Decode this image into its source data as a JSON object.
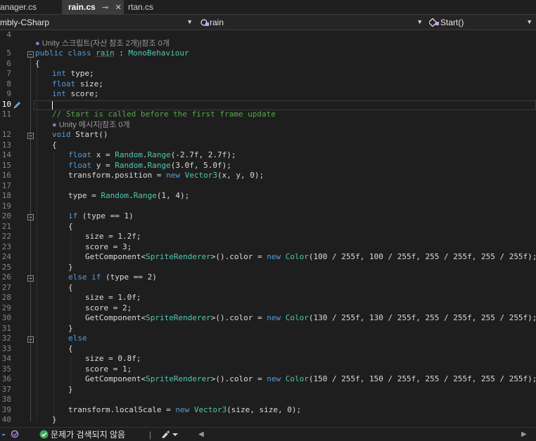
{
  "tabs": [
    {
      "label": "anager.cs",
      "active": false
    },
    {
      "label": "rain.cs",
      "active": true,
      "pin": "⊸",
      "close": "✕"
    },
    {
      "label": "rtan.cs",
      "active": false
    }
  ],
  "nav": {
    "project": "mbly-CSharp",
    "class": "rain",
    "member": "Start()"
  },
  "codelens": {
    "class_refs": "Unity 스크립트(자산 참조 2개)|참조 0개",
    "method_refs": "Unity 메시지|참조 0개"
  },
  "status": {
    "issues": "문제가 검색되지 않음"
  },
  "line_numbers": [
    "4",
    "5",
    "6",
    "7",
    "8",
    "9",
    "10",
    "11",
    "12",
    "13",
    "14",
    "15",
    "16",
    "17",
    "18",
    "19",
    "20",
    "21",
    "22",
    "23",
    "24",
    "25",
    "26",
    "27",
    "28",
    "29",
    "30",
    "31",
    "32",
    "33",
    "34",
    "35",
    "36",
    "37",
    "38",
    "39",
    "40"
  ],
  "code": {
    "l5": [
      "public",
      "class",
      "rain",
      ":",
      "MonoBehaviour"
    ],
    "l6": "{",
    "l7": [
      "int",
      "type;"
    ],
    "l8": [
      "float",
      "size;"
    ],
    "l9": [
      "int",
      "score;"
    ],
    "l11": "// Start is called before the first frame update",
    "l12": [
      "void",
      "Start()"
    ],
    "l13": "{",
    "l14": [
      "float",
      "x = ",
      "Random",
      ".",
      "Range",
      "(-2.7f, 2.7f);"
    ],
    "l15": [
      "float",
      "y = ",
      "Random",
      ".",
      "Range",
      "(3.0f, 5.0f);"
    ],
    "l16": [
      "transform.position = ",
      "new",
      "Vector3",
      "(x, y, 0);"
    ],
    "l18": [
      "type = ",
      "Random",
      ".",
      "Range",
      "(1, 4);"
    ],
    "l20": [
      "if",
      " (type == 1)"
    ],
    "l21": "{",
    "l22": "size = 1.2f;",
    "l23": "score = 3;",
    "l24": [
      "GetComponent<",
      "SpriteRenderer",
      ">().color = ",
      "new",
      "Color",
      "(100 / 255f, 100 / 255f, 255 / 255f, 255 / 255f);"
    ],
    "l25": "}",
    "l26": [
      "else if",
      " (type == 2)"
    ],
    "l27": "{",
    "l28": "size = 1.0f;",
    "l29": "score = 2;",
    "l30": [
      "GetComponent<",
      "SpriteRenderer",
      ">().color = ",
      "new",
      "Color",
      "(130 / 255f, 130 / 255f, 255 / 255f, 255 / 255f);"
    ],
    "l31": "}",
    "l32": "else",
    "l33": "{",
    "l34": "size = 0.8f;",
    "l35": "score = 1;",
    "l36": [
      "GetComponent<",
      "SpriteRenderer",
      ">().color = ",
      "new",
      "Color",
      "(150 / 255f, 150 / 255f, 255 / 255f, 255 / 255f);"
    ],
    "l37": "}",
    "l39": [
      "transform.localScale = ",
      "new",
      "Vector3",
      "(size, size, 0);"
    ],
    "l40": "}"
  },
  "colors": {
    "keyword": "#569cd6",
    "type": "#4ec9b0",
    "comment": "#57a64a",
    "text": "#dcdcdc"
  },
  "icons": [
    "csharp-project-icon",
    "class-icon",
    "method-icon",
    "check-circle-icon",
    "brush-icon",
    "pen-indicator-icon"
  ]
}
